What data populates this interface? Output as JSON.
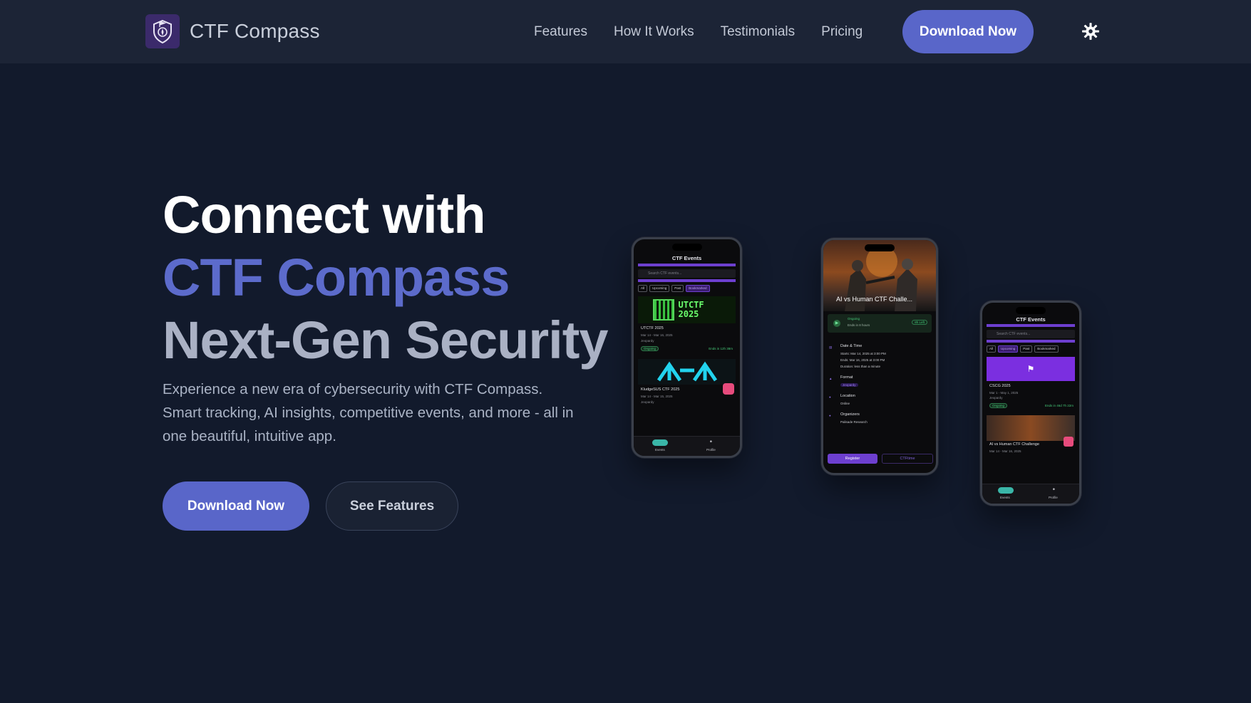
{
  "nav": {
    "brand": "CTF Compass",
    "links": [
      "Features",
      "How It Works",
      "Testimonials",
      "Pricing"
    ],
    "cta": "Download Now",
    "theme_icon": "gear-icon"
  },
  "hero": {
    "line1": "Connect with",
    "line2": "CTF Compass",
    "line3": "Next-Gen Security",
    "subtitle": "Experience a new era of cybersecurity with CTF Compass. Smart tracking, AI insights, competitive events, and more - all in one beautiful, intuitive app.",
    "primary_cta": "Download Now",
    "secondary_cta": "See Features"
  },
  "colors": {
    "accent": "#5966c9",
    "headline_accent": "#5c6bcb",
    "background": "#121a2c",
    "navbar": "#1c2436"
  },
  "phones": {
    "left": {
      "title": "CTF Events",
      "search_placeholder": "Search CTF events...",
      "chips": [
        "All",
        "Upcoming",
        "Past",
        "Bookmarked"
      ],
      "event1_banner": "UTCTF 2025",
      "event1_title": "UTCTF 2025",
      "event1_date": "Mar 14 - Mar 16, 2025",
      "event1_format": "Jeopardy",
      "event1_status": "Ongoing",
      "event1_remaining": "Ends in 12h 38m",
      "event2_title": "KludgeSUS CTF 2025",
      "event2_date": "Mar 14 - Mar 15, 2025",
      "event2_format": "Jeopardy",
      "tab_events": "Events",
      "tab_profile": "Profile"
    },
    "middle": {
      "banner_title": "AI vs Human CTF Challe...",
      "status": "Ongoing",
      "status_detail": "Ends in 8 hours",
      "badge": "8h Left",
      "section_date": "Date & Time",
      "starts": "Starts: Mar 14, 2025 at 3:00 PM",
      "ends": "Ends: Mar 16, 2025 at 3:00 PM",
      "duration": "Duration: less than a minute",
      "section_format": "Format",
      "format_value": "Jeopardy",
      "section_location": "Location",
      "location_value": "Online",
      "section_organizers": "Organizers",
      "organizer_value": "Palisade Research",
      "register": "Register",
      "ctftime": "CTFtime"
    },
    "right": {
      "title": "CTF Events",
      "search_placeholder": "Search CTF events...",
      "chips": [
        "All",
        "Upcoming",
        "Past",
        "Bookmarked"
      ],
      "event1_title": "CSCG 2025",
      "event1_date": "Mar 1 - May 1, 2025",
      "event1_format": "Jeopardy",
      "event1_status": "Ongoing",
      "event1_remaining": "Ends in 46d 7h 22m",
      "event2_title": "AI vs Human CTF Challenge",
      "event2_date": "Mar 14 - Mar 16, 2025",
      "tab_events": "Events",
      "tab_profile": "Profile"
    }
  }
}
